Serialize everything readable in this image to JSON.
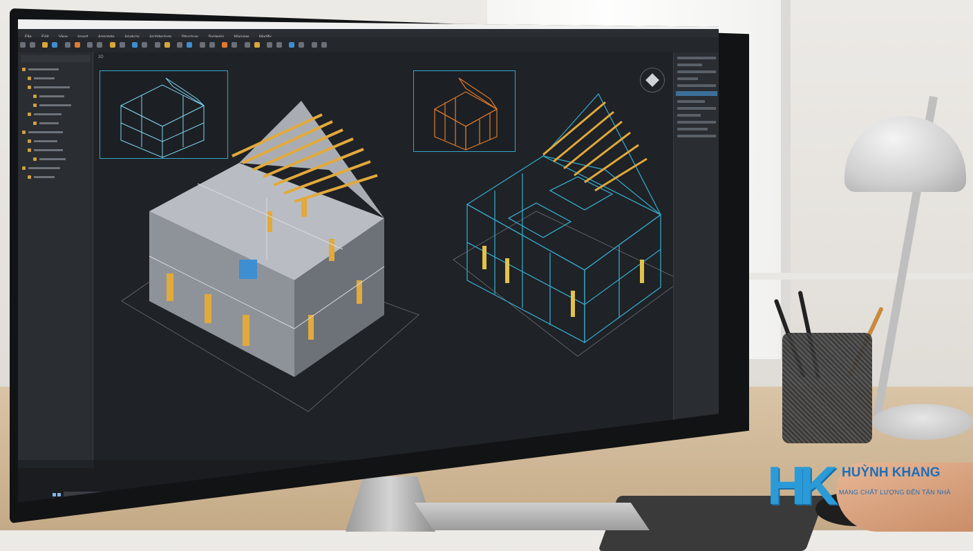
{
  "app": {
    "title_bar_text": "",
    "viewport_tab": "3D",
    "menu_items": [
      "File",
      "Edit",
      "View",
      "Insert",
      "Annotate",
      "Analyze",
      "Architecture",
      "Structure",
      "Systems",
      "Manage",
      "Modify"
    ]
  },
  "taskbar": {
    "search_placeholder": "",
    "active_app_label": ""
  },
  "brand": {
    "name": "HUỲNH KHANG",
    "monogram": "HK",
    "tagline": "MANG CHẤT LƯỢNG ĐẾN TẬN NHÀ",
    "color": "#1f6eb7"
  },
  "colors": {
    "accent_wireframe": "#34a7c9",
    "accent_framing": "#e2a93b",
    "accent_orange": "#e07a2e",
    "viewport_bg": "#1f2226"
  },
  "icons": [
    "start-icon",
    "file-explorer-icon",
    "browser-icon",
    "app-icon",
    "close-icon",
    "minimize-icon",
    "maximize-icon",
    "view-cube-icon"
  ]
}
